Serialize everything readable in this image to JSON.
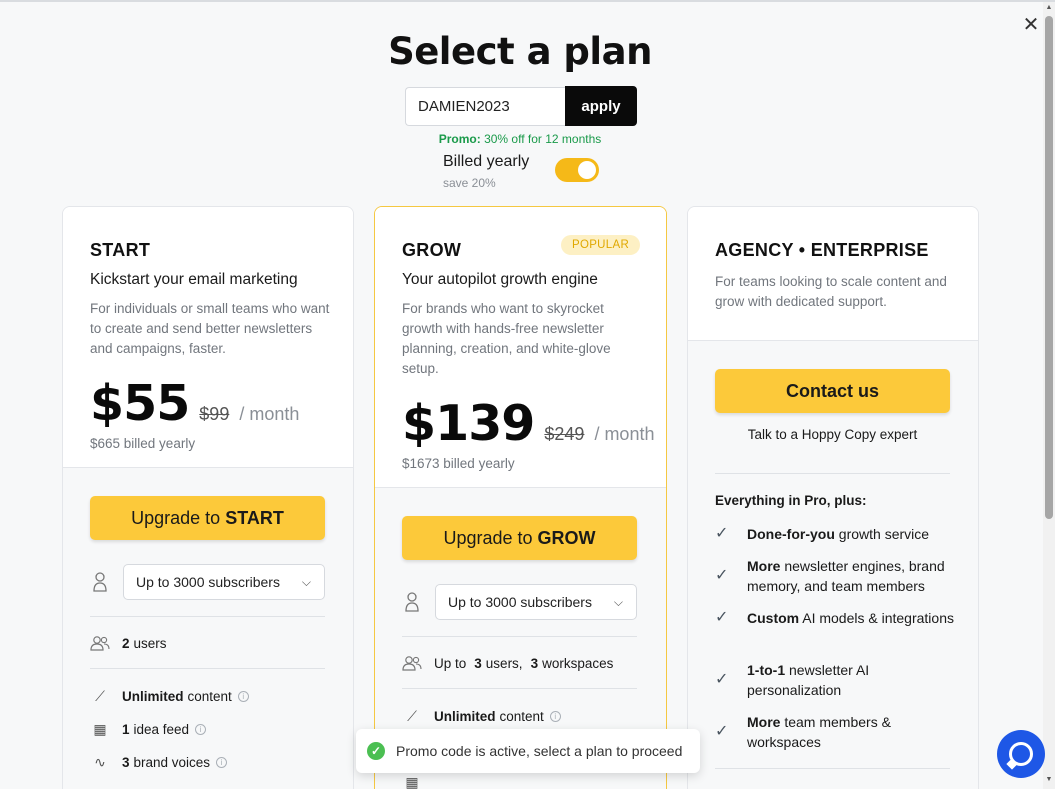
{
  "header": {
    "title": "Select a plan",
    "close_icon": "✕"
  },
  "promo": {
    "code": "DAMIEN2023",
    "apply_label": "apply",
    "note_prefix": "Promo:",
    "note_text": "30% off for 12 months"
  },
  "billing": {
    "label": "Billed yearly",
    "save": "save 20%",
    "yearly_enabled": true,
    "toggle_color": "#f5b918"
  },
  "plans": {
    "start": {
      "name": "START",
      "tagline": "Kickstart your email marketing",
      "description": "For individuals or small teams who want to create and send better newsletters and campaigns, faster.",
      "price": "$55",
      "old_price": "$99",
      "per": "/ month",
      "billed": "$665 billed yearly",
      "cta_prefix": "Upgrade to",
      "cta_plan": "START",
      "subscribers": "Up to 3000 subscribers",
      "users_count": "2",
      "users_label": "users",
      "features": [
        {
          "bold": "Unlimited",
          "text": "content",
          "icon": "magic-wand-icon"
        },
        {
          "bold": "1",
          "text": "idea feed",
          "icon": "calendar-icon"
        },
        {
          "bold": "3",
          "text": "brand voices",
          "icon": "waveform-icon"
        }
      ]
    },
    "grow": {
      "name": "GROW",
      "badge": "POPULAR",
      "tagline": "Your autopilot growth engine",
      "description": "For brands who want to skyrocket growth with hands-free newsletter planning, creation, and white-glove setup.",
      "price": "$139",
      "old_price": "$249",
      "per": "/ month",
      "billed": "$1673 billed yearly",
      "cta_prefix": "Upgrade to",
      "cta_plan": "GROW",
      "subscribers": "Up to 3000 subscribers",
      "users_prefix": "Up to",
      "users_count": "3",
      "users_label": "users,",
      "workspaces_count": "3",
      "workspaces_label": "workspaces",
      "features": [
        {
          "bold": "Unlimited",
          "text": "content",
          "icon": "magic-wand-icon"
        }
      ]
    },
    "agency": {
      "name": "AGENCY • ENTERPRISE",
      "description": "For teams looking to scale content and grow with dedicated support.",
      "cta": "Contact us",
      "cta_sub": "Talk to a Hoppy Copy expert",
      "features_heading": "Everything in Pro, plus:",
      "features": [
        {
          "bold": "Done-for-you",
          "text": " growth service"
        },
        {
          "bold": "More",
          "text": " newsletter engines, brand memory, and team members"
        },
        {
          "bold": "Custom",
          "text": " AI models & integrations"
        },
        {
          "bold": "1-to-1",
          "text": " newsletter AI personalization"
        },
        {
          "bold": "More",
          "text": " team members & workspaces"
        }
      ]
    }
  },
  "toast": {
    "message": "Promo code is active, select a plan to proceed"
  },
  "colors": {
    "accent": "#fcc93a",
    "promo_green": "#1a9a4a",
    "chat_blue": "#1e57e6"
  }
}
